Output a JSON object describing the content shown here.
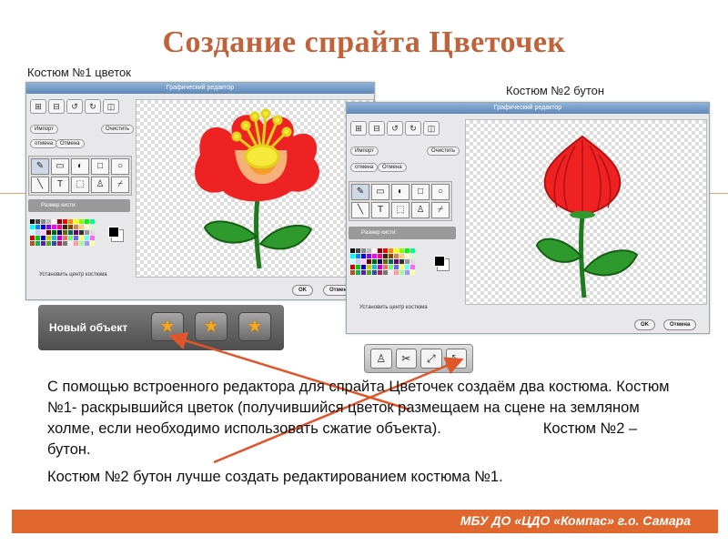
{
  "title": "Создание спрайта Цветочек",
  "costume1_label": "Костюм №1 цветок",
  "costume2_label": "Костюм №2 бутон",
  "editor": {
    "title": "Графический редактор",
    "import": "Импорт",
    "clear": "Очистить",
    "undo": "отмена",
    "redo": "Отмена",
    "brush_size": "Размер кисти:",
    "set_center": "Установить центр костюма",
    "ok": "OK",
    "cancel": "Отмена",
    "cancel_cropped": "Отмен"
  },
  "new_object": {
    "label": "Новый объект"
  },
  "body": {
    "para1_part1": "С помощью встроенного редактора для спрайта Цветочек создаём два костюма. Костюм №1- раскрывшийся цветок (получившийся цветок размещаем на сцене на земляном холме, если необходимо использовать сжатие объекта).",
    "para1_part2": "Костюм №2 – бутон.",
    "para2": "Костюм №2 бутон лучше создать редактированием костюма №1."
  },
  "footer": "МБУ ДО «ЦДО «Компас» г.о. Самара",
  "colors": {
    "title": "#c0633a",
    "footer_bg": "#e0682f",
    "arrow": "#e0552a",
    "petal": "#ee2222"
  }
}
